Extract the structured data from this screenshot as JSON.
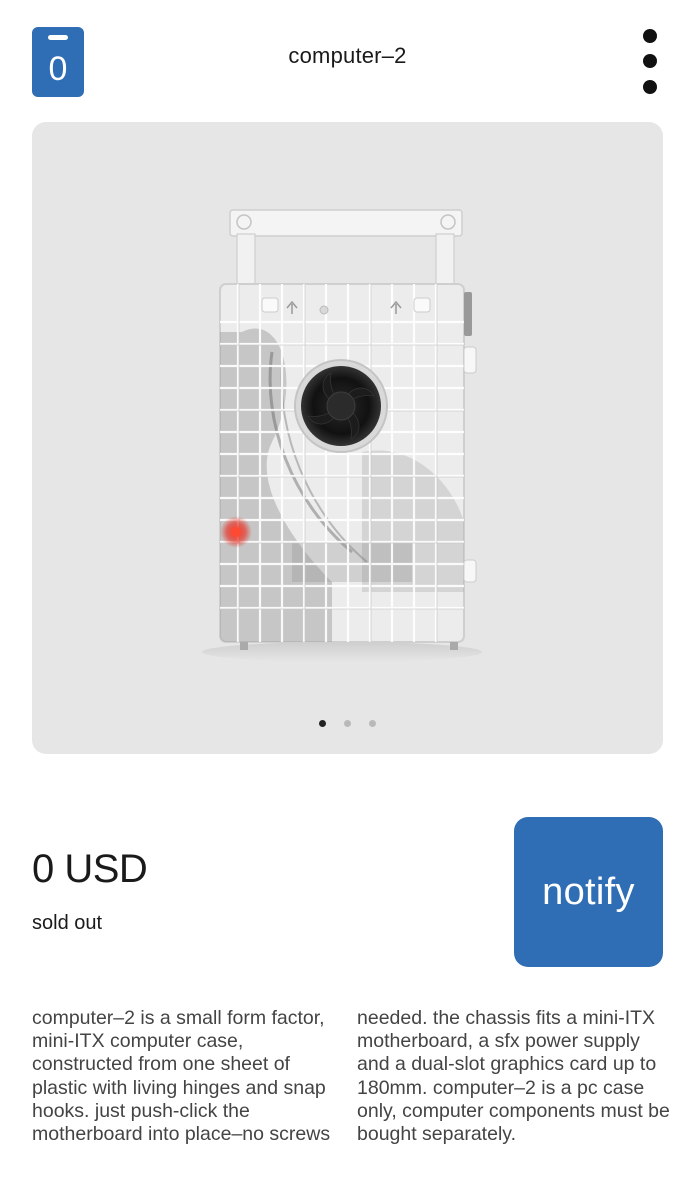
{
  "header": {
    "cart_count": "0",
    "title": "computer–2",
    "menu_icon": "kebab-menu-icon"
  },
  "gallery": {
    "image_alt": "transparent mini-ITX computer case with fan",
    "slide_count": 3,
    "active_slide": 1
  },
  "product": {
    "price": "0 USD",
    "status": "sold out",
    "notify_label": "notify",
    "description": "computer–2 is a small form factor, mini-ITX computer case, constructed from one sheet of plastic with living hinges and snap hooks. just push-click the motherboard into place–no screws needed. the chassis fits a mini-ITX motherboard, a sfx power supply and a dual-slot graphics card up to 180mm. computer–2 is a pc case only, computer components must be bought separately."
  },
  "colors": {
    "accent": "#2f6db5",
    "gallery_bg": "#e6e6e6",
    "text": "#1a1a1a"
  }
}
